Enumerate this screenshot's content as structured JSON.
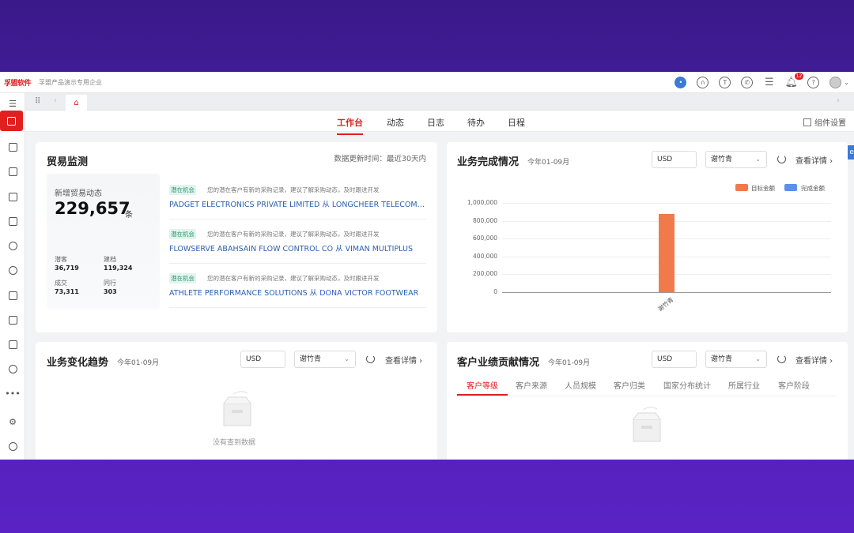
{
  "topbar": {
    "logo": "孚盟软件",
    "company": "孚盟产品演示专用企业",
    "bell_badge": "12"
  },
  "tabs": {
    "home_tab": "home"
  },
  "nav": {
    "items": [
      "工作台",
      "动态",
      "日志",
      "待办",
      "日程"
    ],
    "active": "工作台",
    "widget_settings": "组件设置"
  },
  "trade": {
    "title": "贸易监测",
    "update_info": "数据更新时间：最近30天内",
    "new_label": "新增贸易动态",
    "new_count": "229,657",
    "unit": "条",
    "stats": [
      {
        "label": "潜客",
        "value": "36,719"
      },
      {
        "label": "建档",
        "value": "119,324"
      },
      {
        "label": "成交",
        "value": "73,311"
      },
      {
        "label": "同行",
        "value": "303"
      }
    ],
    "feed": [
      {
        "tag": "潜在机会",
        "desc": "您的潜在客户有新的采购记录，建议了解采购动态，及时跟进开发",
        "link": "PADGET ELECTRONICS PRIVATE LIMITED 从 LONGCHEER TELECOMMUNICATION"
      },
      {
        "tag": "潜在机会",
        "desc": "您的潜在客户有新的采购记录，建议了解采购动态，及时跟进开发",
        "link": "FLOWSERVE ABAHSAIN FLOW CONTROL CO 从 VIMAN MULTIPLUS"
      },
      {
        "tag": "潜在机会",
        "desc": "您的潜在客户有新的采购记录，建议了解采购动态，及时跟进开发",
        "link": "ATHLETE PERFORMANCE SOLUTIONS 从 DONA VICTOR FOOTWEAR"
      }
    ]
  },
  "completion": {
    "title": "业务完成情况",
    "period": "今年01-09月",
    "currency": "USD",
    "person": "谢竹青",
    "detail": "查看详情",
    "legend": [
      {
        "name": "目标金额",
        "color": "#f07a4a"
      },
      {
        "name": "完成金额",
        "color": "#5b8ff0"
      }
    ]
  },
  "chart_data": {
    "type": "bar",
    "categories": [
      "谢竹青"
    ],
    "series": [
      {
        "name": "目标金额",
        "values": [
          880000
        ]
      },
      {
        "name": "完成金额",
        "values": [
          0
        ]
      }
    ],
    "yticks": [
      "1,000,000",
      "800,000",
      "600,000",
      "400,000",
      "200,000",
      "0"
    ],
    "ylim": [
      0,
      1000000
    ],
    "legend_position": "top-right"
  },
  "trend": {
    "title": "业务变化趋势",
    "period": "今年01-09月",
    "currency": "USD",
    "person": "谢竹青",
    "detail": "查看详情",
    "empty": "没有查到数据"
  },
  "contribution": {
    "title": "客户业绩贡献情况",
    "period": "今年01-09月",
    "currency": "USD",
    "person": "谢竹青",
    "detail": "查看详情",
    "tabs": [
      "客户等级",
      "客户来源",
      "人员规模",
      "客户归类",
      "国家分布统计",
      "所属行业",
      "客户阶段"
    ]
  },
  "colors": {
    "accent": "#e02020",
    "link": "#2c5fb0"
  }
}
